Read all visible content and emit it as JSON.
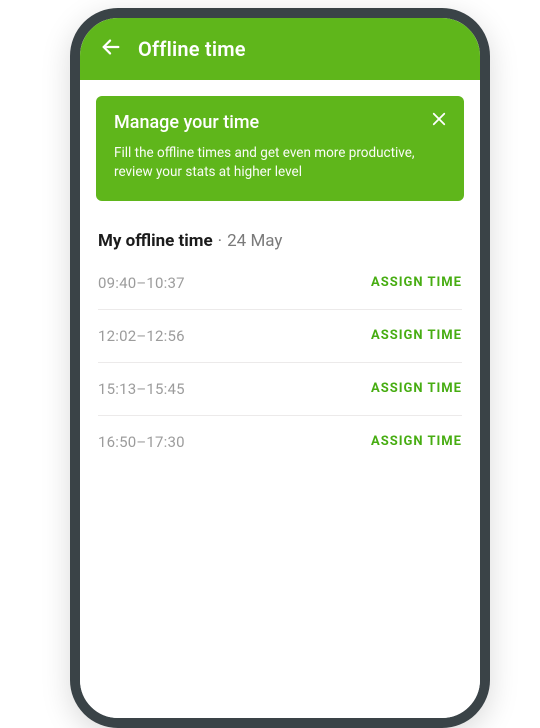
{
  "header": {
    "title": "Offline time"
  },
  "banner": {
    "title": "Manage your time",
    "body": "Fill the offline times and get even more productive, review your stats at higher level"
  },
  "section": {
    "title": "My offline time",
    "date": "24 May"
  },
  "rows": [
    {
      "range": "09:40–10:37",
      "action": "ASSIGN TIME"
    },
    {
      "range": "12:02–12:56",
      "action": "ASSIGN TIME"
    },
    {
      "range": "15:13–15:45",
      "action": "ASSIGN TIME"
    },
    {
      "range": "16:50–17:30",
      "action": "ASSIGN TIME"
    }
  ]
}
